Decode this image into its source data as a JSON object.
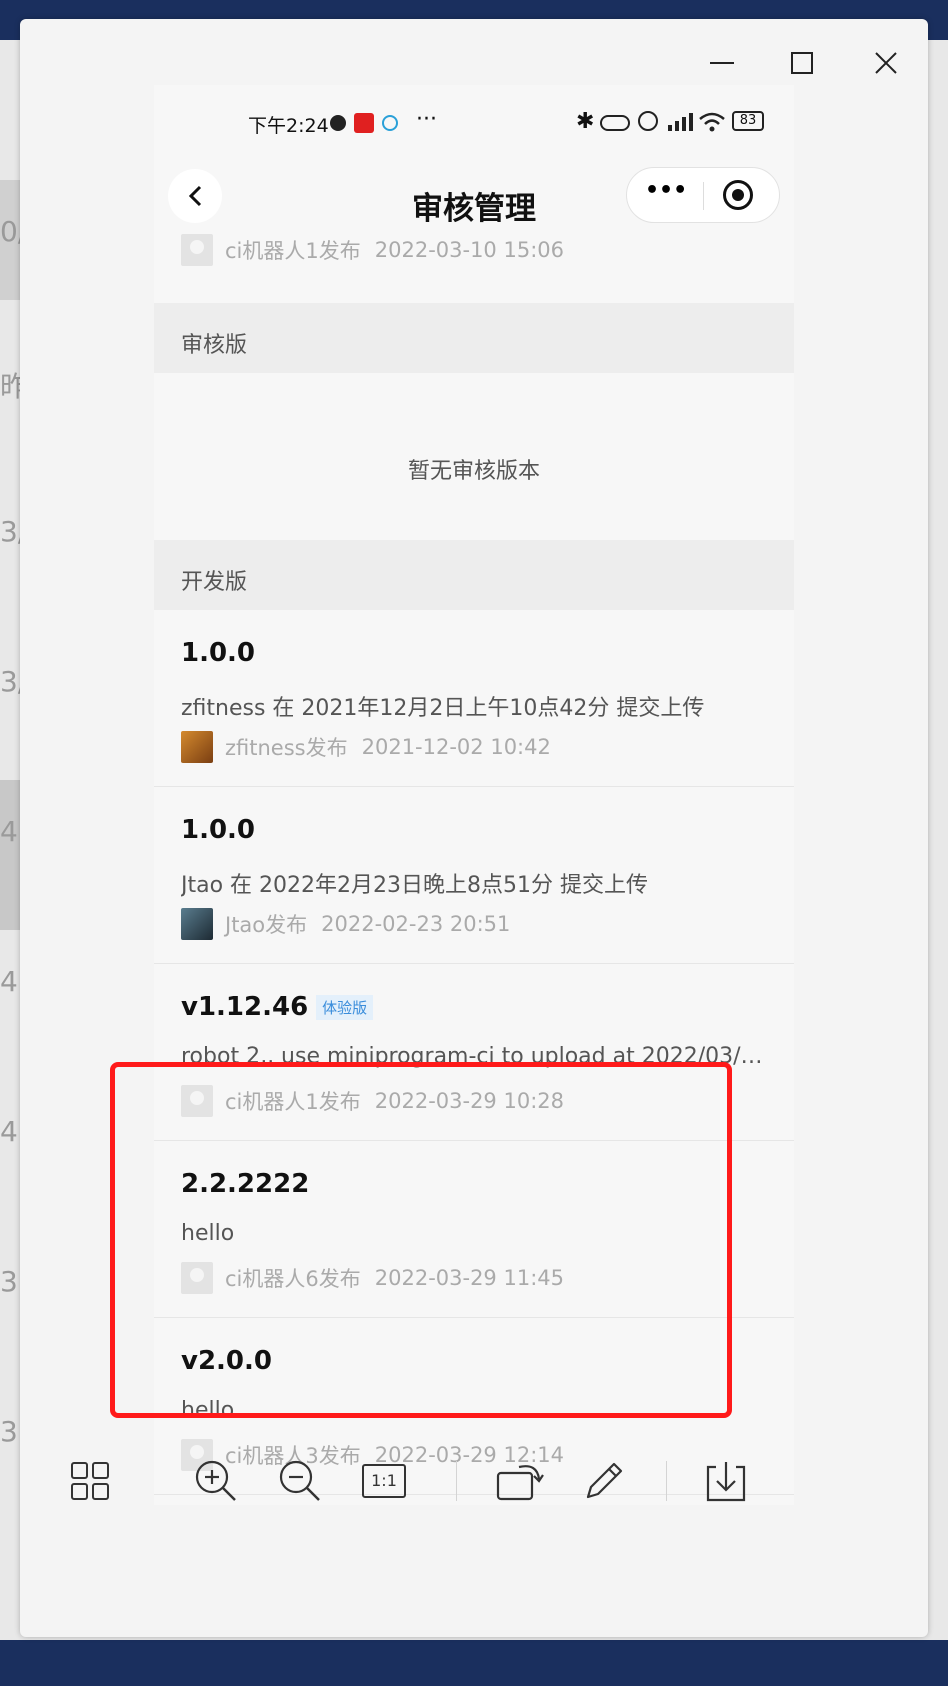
{
  "background_app": {
    "left_edge_chars": [
      "0/",
      "昨",
      "3/",
      "3/",
      "4",
      "4",
      "4",
      "3",
      "3"
    ]
  },
  "window": {
    "controls": {
      "minimize": "minimize",
      "maximize": "maximize",
      "close": "close"
    }
  },
  "status_bar": {
    "time": "下午2:24",
    "more": "···",
    "battery": "83"
  },
  "nav": {
    "title": "审核管理",
    "capsule_more": "•••"
  },
  "peek_row": {
    "meta": "ci机器人1发布",
    "time": "2022-03-10 15:06"
  },
  "review_section": {
    "header": "审核版",
    "empty_text": "暂无审核版本"
  },
  "dev_section": {
    "header": "开发版",
    "items": [
      {
        "version": "1.0.0",
        "desc": "zfitness 在 2021年12月2日上午10点42分 提交上传",
        "publisher": "zfitness发布",
        "time": "2021-12-02 10:42",
        "avatar": "tiger-avatar",
        "badge": ""
      },
      {
        "version": "1.0.0",
        "desc": "Jtao 在 2022年2月23日晚上8点51分 提交上传",
        "publisher": "Jtao发布",
        "time": "2022-02-23 20:51",
        "avatar": "photo-avatar",
        "badge": ""
      },
      {
        "version": "v1.12.46",
        "desc": "robot 2,, use miniprogram-ci to upload at 2022/03/2…",
        "publisher": "ci机器人1发布",
        "time": "2022-03-29 10:28",
        "avatar": "default-avatar",
        "badge": "体验版"
      },
      {
        "version": "2.2.2222",
        "desc": "hello",
        "publisher": "ci机器人6发布",
        "time": "2022-03-29 11:45",
        "avatar": "default-avatar",
        "badge": ""
      },
      {
        "version": "v2.0.0",
        "desc": "hello",
        "publisher": "ci机器人3发布",
        "time": "2022-03-29 12:14",
        "avatar": "default-avatar",
        "badge": ""
      }
    ]
  },
  "toolbar": {
    "icons": [
      "grid-icon",
      "zoom-in-icon",
      "zoom-out-icon",
      "actual-size-icon",
      "rotate-icon",
      "edit-icon",
      "download-icon"
    ],
    "actual_size_label": "1:1"
  },
  "colors": {
    "highlight": "#ff1a1a",
    "badge_text": "#3a8ddb",
    "badge_bg": "#e4f0fb",
    "frame": "#1a2f5e"
  }
}
